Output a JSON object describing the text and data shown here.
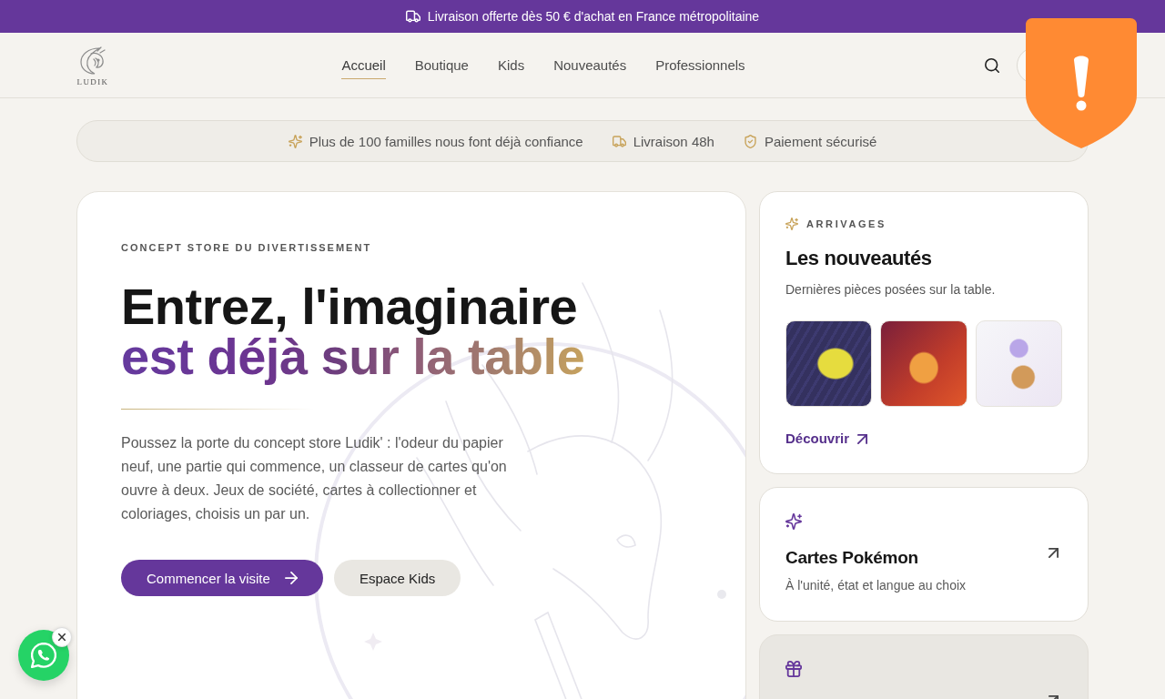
{
  "announcement": {
    "text": "Livraison offerte dès 50 € d'achat en France métropolitaine"
  },
  "header": {
    "logo_text": "LUDIK",
    "nav": [
      {
        "label": "Accueil",
        "selected": true
      },
      {
        "label": "Boutique",
        "selected": false
      },
      {
        "label": "Kids",
        "selected": false
      },
      {
        "label": "Nouveautés",
        "selected": false
      },
      {
        "label": "Professionnels",
        "selected": false
      }
    ]
  },
  "trust_bar": [
    {
      "text": "Plus de 100 familles nous font déjà confiance"
    },
    {
      "text": "Livraison 48h"
    },
    {
      "text": "Paiement sécurisé"
    }
  ],
  "hero": {
    "eyebrow": "CONCEPT STORE DU DIVERTISSEMENT",
    "headline": [
      {
        "text": "Entrez, l'imaginaire",
        "kind": "dark"
      },
      {
        "text": "est déjà sur la table",
        "kind": "gradient"
      }
    ],
    "paragraph": "Poussez la porte du concept store Ludik' : l'odeur du papier neuf, une partie qui commence, un classeur de cartes qu'on ouvre à deux. Jeux de société, cartes à collectionner et coloriages, choisis un par un.",
    "buttons": [
      {
        "label": "Commencer la visite",
        "kind": "primary"
      },
      {
        "label": "Espace Kids",
        "kind": "secondary"
      }
    ]
  },
  "arrivals": {
    "eyebrow": "ARRIVAGES",
    "title": "Les nouveautés",
    "subtitle": "Dernières pièces posées sur la table.",
    "link": "Découvrir"
  },
  "categories": [
    {
      "kind": "plain",
      "title": "Cartes Pokémon",
      "subtitle": "À l'unité, état et langue au choix"
    },
    {
      "kind": "shaded"
    }
  ]
}
